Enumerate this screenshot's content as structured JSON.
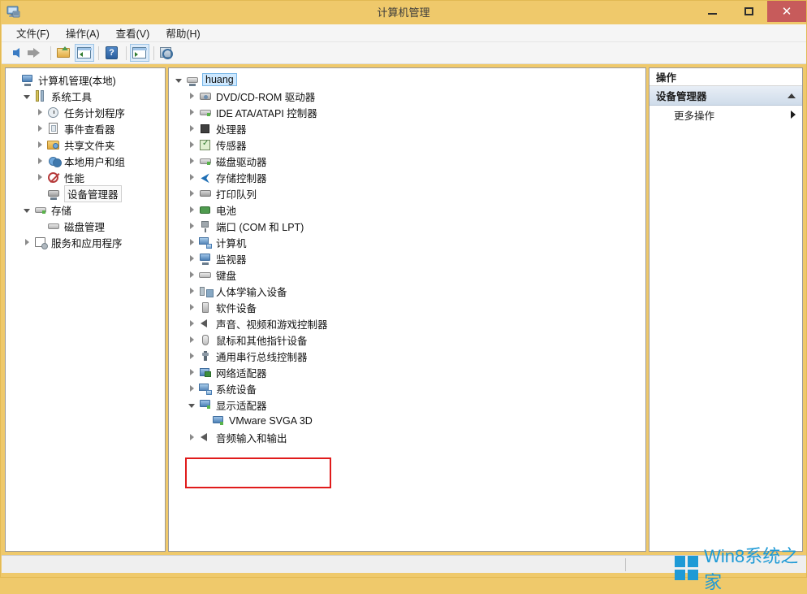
{
  "window": {
    "title": "计算机管理",
    "app_icon": "computer-management-icon",
    "minimize_label": "最小化",
    "maximize_label": "最大化",
    "close_label": "关闭",
    "close_glyph": "✕",
    "close_color": "#c75b5b",
    "titlebar_color": "#efc96b"
  },
  "menu": {
    "items": [
      {
        "label": "文件(F)"
      },
      {
        "label": "操作(A)"
      },
      {
        "label": "查看(V)"
      },
      {
        "label": "帮助(H)"
      }
    ]
  },
  "toolbar": {
    "buttons": [
      {
        "name": "back-button",
        "icon": "back-arrow-icon",
        "active": false
      },
      {
        "name": "forward-button",
        "icon": "forward-arrow-icon",
        "active": false
      },
      {
        "name": "up-folder-button",
        "icon": "up-folder-icon",
        "active": false
      },
      {
        "name": "show-hide-tree-button",
        "icon": "console-tree-icon",
        "active": true
      },
      {
        "name": "help-button",
        "icon": "help-icon",
        "active": false
      },
      {
        "name": "show-action-pane-button",
        "icon": "action-pane-icon",
        "active": true
      },
      {
        "name": "refresh-button",
        "icon": "properties-icon",
        "active": false
      }
    ],
    "help_glyph": "?"
  },
  "left_tree": {
    "items": [
      {
        "label": "计算机管理(本地)",
        "indent": 0,
        "twist": "none",
        "icon": "computer-management-icon",
        "selected": "none"
      },
      {
        "label": "系统工具",
        "indent": 1,
        "twist": "open",
        "icon": "system-tools-icon",
        "selected": "none"
      },
      {
        "label": "任务计划程序",
        "indent": 2,
        "twist": "closed",
        "icon": "task-scheduler-icon",
        "selected": "none"
      },
      {
        "label": "事件查看器",
        "indent": 2,
        "twist": "closed",
        "icon": "event-viewer-icon",
        "selected": "none"
      },
      {
        "label": "共享文件夹",
        "indent": 2,
        "twist": "closed",
        "icon": "shared-folders-icon",
        "selected": "none"
      },
      {
        "label": "本地用户和组",
        "indent": 2,
        "twist": "closed",
        "icon": "local-users-groups-icon",
        "selected": "none"
      },
      {
        "label": "性能",
        "indent": 2,
        "twist": "closed",
        "icon": "performance-icon",
        "selected": "none"
      },
      {
        "label": "设备管理器",
        "indent": 2,
        "twist": "none",
        "icon": "device-manager-icon",
        "selected": "gray"
      },
      {
        "label": "存储",
        "indent": 1,
        "twist": "open",
        "icon": "storage-icon",
        "selected": "none"
      },
      {
        "label": "磁盘管理",
        "indent": 2,
        "twist": "none",
        "icon": "disk-management-icon",
        "selected": "none"
      },
      {
        "label": "服务和应用程序",
        "indent": 1,
        "twist": "closed",
        "icon": "services-apps-icon",
        "selected": "none"
      }
    ]
  },
  "device_tree": {
    "items": [
      {
        "label": "huang",
        "indent": 0,
        "twist": "open",
        "icon": "computer-root-icon",
        "selected": "blue"
      },
      {
        "label": "DVD/CD-ROM 驱动器",
        "indent": 1,
        "twist": "closed",
        "icon": "dvd-drive-icon",
        "selected": "none"
      },
      {
        "label": "IDE ATA/ATAPI 控制器",
        "indent": 1,
        "twist": "closed",
        "icon": "ide-controller-icon",
        "selected": "none"
      },
      {
        "label": "处理器",
        "indent": 1,
        "twist": "closed",
        "icon": "processor-icon",
        "selected": "none"
      },
      {
        "label": "传感器",
        "indent": 1,
        "twist": "closed",
        "icon": "sensor-icon",
        "selected": "none"
      },
      {
        "label": "磁盘驱动器",
        "indent": 1,
        "twist": "closed",
        "icon": "disk-drive-icon",
        "selected": "none"
      },
      {
        "label": "存储控制器",
        "indent": 1,
        "twist": "closed",
        "icon": "storage-controller-icon",
        "selected": "none"
      },
      {
        "label": "打印队列",
        "indent": 1,
        "twist": "closed",
        "icon": "print-queue-icon",
        "selected": "none"
      },
      {
        "label": "电池",
        "indent": 1,
        "twist": "closed",
        "icon": "battery-icon",
        "selected": "none"
      },
      {
        "label": "端口 (COM 和 LPT)",
        "indent": 1,
        "twist": "closed",
        "icon": "ports-icon",
        "selected": "none"
      },
      {
        "label": "计算机",
        "indent": 1,
        "twist": "closed",
        "icon": "computer-icon",
        "selected": "none"
      },
      {
        "label": "监视器",
        "indent": 1,
        "twist": "closed",
        "icon": "monitor-icon",
        "selected": "none"
      },
      {
        "label": "键盘",
        "indent": 1,
        "twist": "closed",
        "icon": "keyboard-icon",
        "selected": "none"
      },
      {
        "label": "人体学输入设备",
        "indent": 1,
        "twist": "closed",
        "icon": "hid-icon",
        "selected": "none"
      },
      {
        "label": "软件设备",
        "indent": 1,
        "twist": "closed",
        "icon": "software-device-icon",
        "selected": "none"
      },
      {
        "label": "声音、视频和游戏控制器",
        "indent": 1,
        "twist": "closed",
        "icon": "sound-video-game-icon",
        "selected": "none"
      },
      {
        "label": "鼠标和其他指针设备",
        "indent": 1,
        "twist": "closed",
        "icon": "mouse-icon",
        "selected": "none"
      },
      {
        "label": "通用串行总线控制器",
        "indent": 1,
        "twist": "closed",
        "icon": "usb-controller-icon",
        "selected": "none"
      },
      {
        "label": "网络适配器",
        "indent": 1,
        "twist": "closed",
        "icon": "network-adapter-icon",
        "selected": "none"
      },
      {
        "label": "系统设备",
        "indent": 1,
        "twist": "closed",
        "icon": "system-device-icon",
        "selected": "none"
      },
      {
        "label": "显示适配器",
        "indent": 1,
        "twist": "open",
        "icon": "display-adapter-icon",
        "selected": "none"
      },
      {
        "label": "VMware SVGA 3D",
        "indent": 2,
        "twist": "none",
        "icon": "display-adapter-icon",
        "selected": "none"
      },
      {
        "label": "音频输入和输出",
        "indent": 1,
        "twist": "closed",
        "icon": "audio-io-icon",
        "selected": "none"
      }
    ]
  },
  "actions_pane": {
    "header": "操作",
    "section_title": "设备管理器",
    "collapse_icon": "caret-up-icon",
    "items": [
      {
        "label": "更多操作",
        "submenu_icon": "caret-right-icon"
      }
    ]
  },
  "annotation": {
    "color": "#e01b1b",
    "name": "display-adapter-highlight"
  },
  "watermark": {
    "text": "Win8系统之家",
    "logo": "windows-logo-icon",
    "color": "#1e9ad6"
  },
  "statusbar": {
    "text": ""
  }
}
